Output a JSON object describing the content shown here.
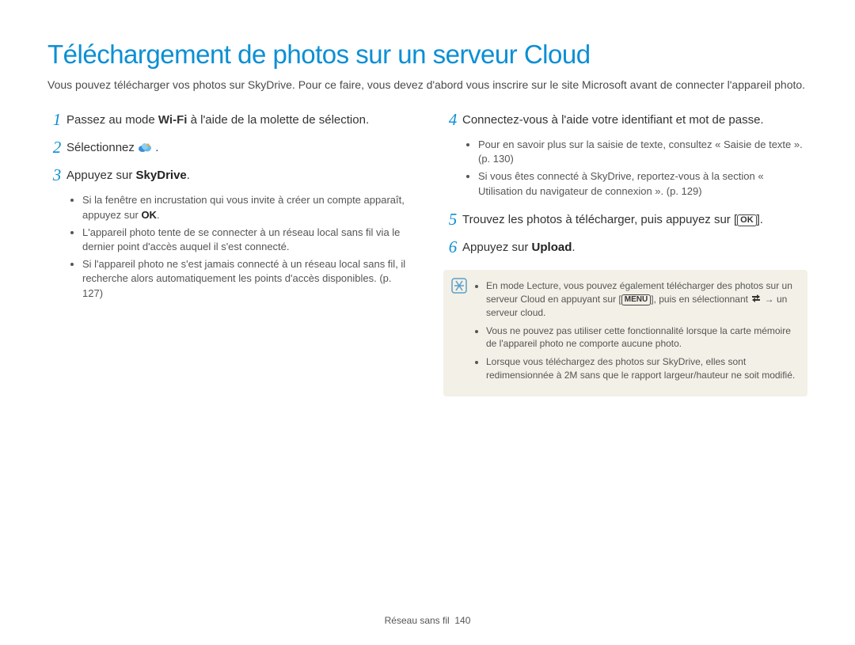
{
  "title": "Téléchargement de photos sur un serveur Cloud",
  "intro": "Vous pouvez télécharger vos photos sur SkyDrive. Pour ce faire, vous devez d'abord vous inscrire sur le site Microsoft avant de connecter l'appareil photo.",
  "left": {
    "step1": {
      "num": "1",
      "pre": "Passez au mode ",
      "wifi": "Wi-Fi",
      "post": " à l'aide de la molette de sélection."
    },
    "step2": {
      "num": "2",
      "pre": "Sélectionnez ",
      "post": "."
    },
    "step3": {
      "num": "3",
      "pre": "Appuyez sur ",
      "bold": "SkyDrive",
      "post": ".",
      "bullets": [
        {
          "pre": "Si la fenêtre en incrustation qui vous invite à créer un compte apparaît, appuyez sur ",
          "bold": "OK",
          "post": "."
        },
        {
          "text": "L'appareil photo tente de se connecter à un réseau local sans fil via le dernier point d'accès auquel il s'est connecté."
        },
        {
          "text": "Si l'appareil photo ne s'est jamais connecté à un réseau local sans fil, il recherche alors automatiquement les points d'accès disponibles. (p. 127)"
        }
      ]
    }
  },
  "right": {
    "step4": {
      "num": "4",
      "text": "Connectez-vous à l'aide votre identifiant et mot de passe.",
      "bullets": [
        {
          "text": "Pour en savoir plus sur la saisie de texte, consultez « Saisie de texte ». (p. 130)"
        },
        {
          "text": "Si vous êtes connecté à SkyDrive, reportez-vous à la section « Utilisation du navigateur de connexion ». (p. 129)"
        }
      ]
    },
    "step5": {
      "num": "5",
      "pre": "Trouvez les photos à télécharger, puis appuyez sur [",
      "post": "]."
    },
    "step6": {
      "num": "6",
      "pre": "Appuyez sur ",
      "bold": "Upload",
      "post": "."
    },
    "note": {
      "items": [
        {
          "pre": "En mode Lecture, vous pouvez également télécharger des photos sur un serveur Cloud en appuyant sur [",
          "mid": "], puis en sélectionnant ",
          "post": " → un serveur cloud."
        },
        {
          "text": "Vous ne pouvez pas utiliser cette fonctionnalité lorsque la carte mémoire de l'appareil photo ne comporte aucune photo."
        },
        {
          "text": "Lorsque vous téléchargez des photos sur SkyDrive, elles sont redimensionnée à 2M sans que le rapport largeur/hauteur ne soit modifié."
        }
      ]
    }
  },
  "footer": {
    "section": "Réseau sans fil",
    "page": "140"
  }
}
